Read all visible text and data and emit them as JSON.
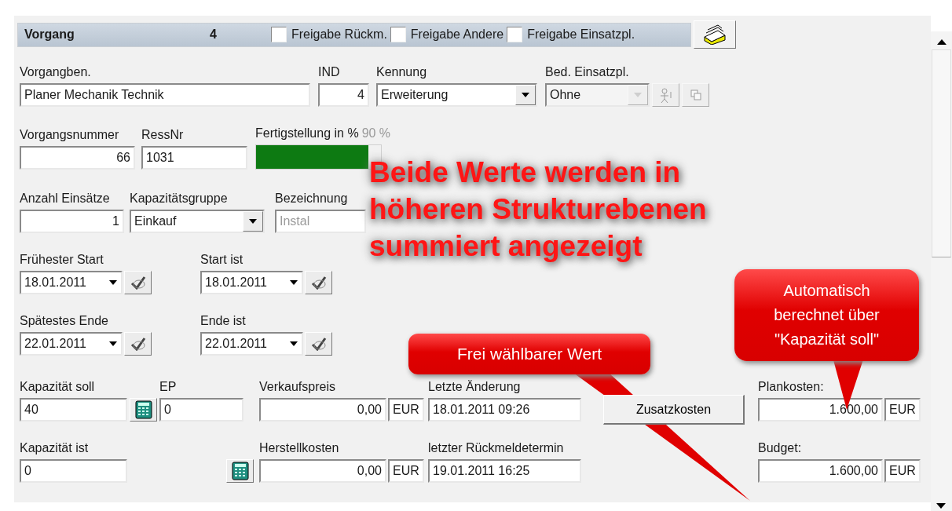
{
  "header": {
    "title": "Vorgang",
    "number": "4",
    "checkboxes": [
      {
        "label": "Freigabe Rückm.",
        "checked": false
      },
      {
        "label": "Freigabe Andere",
        "checked": false
      },
      {
        "label": "Freigabe Einsatzpl.",
        "checked": false
      }
    ]
  },
  "rows": [
    {
      "fields": [
        {
          "kind": "text",
          "label": "Vorgangben.",
          "value": "Planer Mechanik Technik",
          "disabled": false
        },
        {
          "kind": "number",
          "label": "IND",
          "value": "4",
          "disabled": false
        },
        {
          "kind": "combo",
          "label": "Kennung",
          "value": "Erweiterung",
          "disabled": false
        },
        {
          "kind": "combo",
          "label": "Bed. Einsatzpl.",
          "value": "Ohne",
          "disabled": true
        },
        {
          "kind": "iconbutton",
          "disabled": true
        },
        {
          "kind": "iconbutton",
          "disabled": true
        }
      ]
    },
    {
      "fields": [
        {
          "kind": "number",
          "label": "Vorgangsnummer",
          "value": "66",
          "disabled": false
        },
        {
          "kind": "text",
          "label": "RessNr",
          "value": "1031",
          "disabled": false
        },
        {
          "kind": "progress",
          "label": "Fertigstellung in %",
          "reading": "90 %",
          "level": 0.9
        }
      ]
    },
    {
      "fields": [
        {
          "kind": "number",
          "label": "Anzahl Einsätze",
          "value": "1",
          "disabled": false
        },
        {
          "kind": "combo",
          "label": "Kapazitätsgruppe",
          "value": "Einkauf",
          "disabled": false
        },
        {
          "kind": "text",
          "label": "Bezeichnung",
          "value": "Instal",
          "disabled": true
        }
      ]
    },
    {
      "fields": [
        {
          "kind": "date",
          "label": "Frühester Start",
          "value": "18.01.2011"
        },
        {
          "kind": "date",
          "label": "Start ist",
          "value": "18.01.2011"
        }
      ]
    },
    {
      "fields": [
        {
          "kind": "date",
          "label": "Spätestes Ende",
          "value": "22.01.2011"
        },
        {
          "kind": "date",
          "label": "Ende ist",
          "value": "22.01.2011"
        }
      ]
    },
    {
      "fields": [
        {
          "kind": "text",
          "label": "Kapazität soll",
          "value": "40",
          "disabled": false
        },
        {
          "kind": "calc"
        },
        {
          "kind": "text",
          "label": "EP",
          "value": "0",
          "disabled": false
        },
        {
          "kind": "currency",
          "label": "Verkaufspreis",
          "value": "0,00",
          "unit": "EUR"
        },
        {
          "kind": "text",
          "label": "Letzte Änderung",
          "value": "18.01.2011 09:26",
          "disabled": false
        },
        {
          "kind": "button",
          "label": "Zusatzkosten"
        },
        {
          "kind": "currency",
          "label": "Plankosten:",
          "value": "1.600,00",
          "unit": "EUR"
        }
      ]
    },
    {
      "fields": [
        {
          "kind": "text",
          "label": "Kapazität ist",
          "value": "0",
          "disabled": false
        },
        {
          "kind": "calc"
        },
        {
          "kind": "currency",
          "label": "Herstellkosten",
          "value": "0,00",
          "unit": "EUR"
        },
        {
          "kind": "text",
          "label": "letzter Rückmeldetermin",
          "value": "19.01.2011 16:25",
          "disabled": false
        },
        {
          "kind": "currency",
          "label": "Budget:",
          "value": "1.600,00",
          "unit": "EUR"
        }
      ]
    }
  ],
  "annotations": [
    {
      "kind": "headline",
      "text": "Beide Werte werden in\nhöheren Strukturebenen\nsummiert angezeigt"
    },
    {
      "kind": "callout",
      "text": "Frei wählbarer Wert"
    },
    {
      "kind": "callout",
      "text": "Automatisch\nberechnet über\n\"Kapazität soll\""
    }
  ]
}
